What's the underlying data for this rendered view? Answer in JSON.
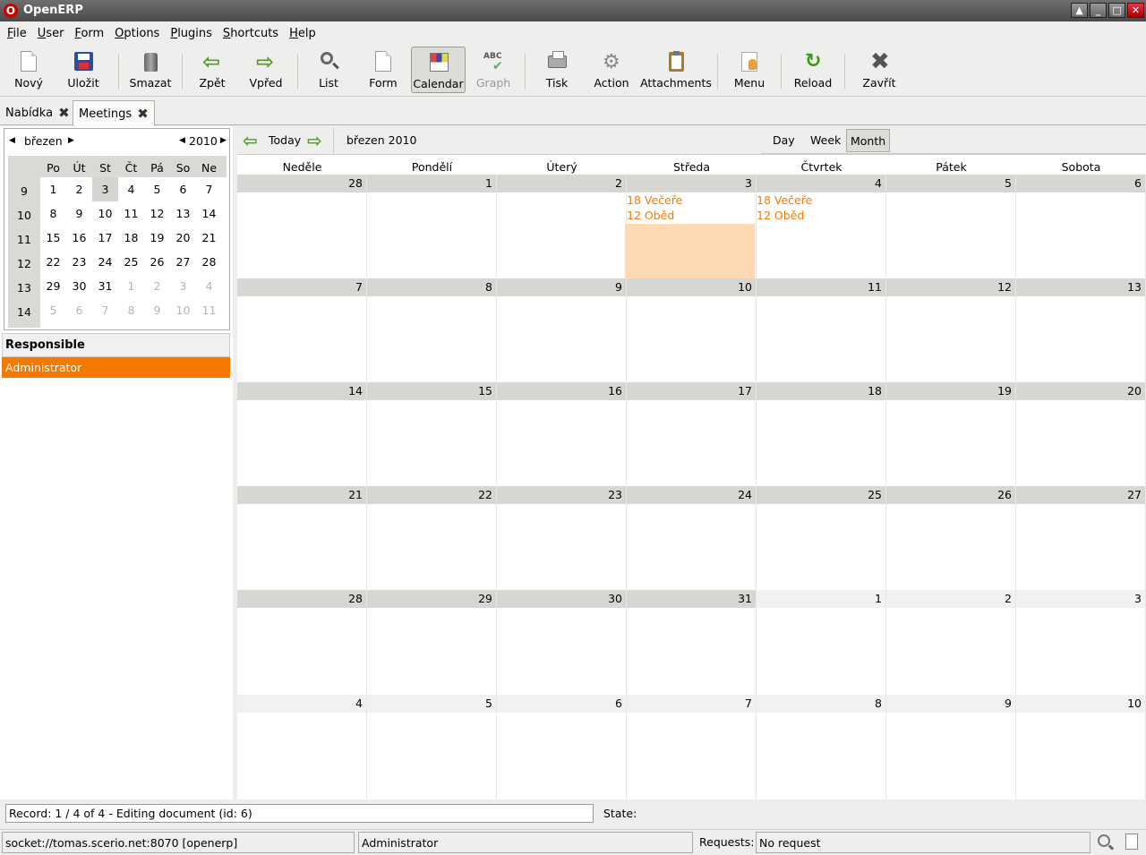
{
  "window": {
    "title": "OpenERP"
  },
  "menubar": [
    "File",
    "User",
    "Form",
    "Options",
    "Plugins",
    "Shortcuts",
    "Help"
  ],
  "toolbar": {
    "new": "Nový",
    "save": "Uložit",
    "delete": "Smazat",
    "back": "Zpět",
    "forward": "Vpřed",
    "list": "List",
    "form": "Form",
    "calendar": "Calendar",
    "graph": "Graph",
    "print": "Tisk",
    "action": "Action",
    "attachments": "Attachments",
    "menu": "Menu",
    "reload": "Reload",
    "close": "Zavřít"
  },
  "tabs": [
    {
      "label": "Nabídka",
      "active": false
    },
    {
      "label": "Meetings",
      "active": true
    }
  ],
  "minical": {
    "month": "březen",
    "year": "2010",
    "day_headers": [
      "Po",
      "Út",
      "St",
      "Čt",
      "Pá",
      "So",
      "Ne"
    ],
    "week_numbers": [
      "9",
      "10",
      "11",
      "12",
      "13",
      "14"
    ],
    "rows": [
      [
        "1",
        "2",
        "3",
        "4",
        "5",
        "6",
        "7"
      ],
      [
        "8",
        "9",
        "10",
        "11",
        "12",
        "13",
        "14"
      ],
      [
        "15",
        "16",
        "17",
        "18",
        "19",
        "20",
        "21"
      ],
      [
        "22",
        "23",
        "24",
        "25",
        "26",
        "27",
        "28"
      ],
      [
        "29",
        "30",
        "31",
        "1",
        "2",
        "3",
        "4"
      ],
      [
        "5",
        "6",
        "7",
        "8",
        "9",
        "10",
        "11"
      ]
    ],
    "selected": "3"
  },
  "responsible": {
    "header": "Responsible",
    "items": [
      "Administrator"
    ]
  },
  "calendar": {
    "today_label": "Today",
    "month_label": "březen 2010",
    "modes": [
      "Day",
      "Week",
      "Month"
    ],
    "active_mode": "Month",
    "weekdays": [
      "Neděle",
      "Pondělí",
      "Úterý",
      "Středa",
      "Čtvrtek",
      "Pátek",
      "Sobota"
    ],
    "weeks": [
      [
        "28",
        "1",
        "2",
        "3",
        "4",
        "5",
        "6"
      ],
      [
        "7",
        "8",
        "9",
        "10",
        "11",
        "12",
        "13"
      ],
      [
        "14",
        "15",
        "16",
        "17",
        "18",
        "19",
        "20"
      ],
      [
        "21",
        "22",
        "23",
        "24",
        "25",
        "26",
        "27"
      ],
      [
        "28",
        "29",
        "30",
        "31",
        "1",
        "2",
        "3"
      ],
      [
        "4",
        "5",
        "6",
        "7",
        "8",
        "9",
        "10"
      ]
    ],
    "events": {
      "wed_3": [
        "18 Večeře",
        "12 Oběd"
      ],
      "thu_4": [
        "18 Večeře",
        "12 Oběd"
      ]
    },
    "colors": {
      "event": "#f57900",
      "highlight": "#ffd9b4"
    }
  },
  "status": {
    "record": "Record: 1 / 4 of 4 - Editing document (id: 6)",
    "state_label": "State:",
    "server": "socket://tomas.scerio.net:8070 [openerp]",
    "user": "Administrator",
    "requests_label": "Requests:",
    "requests_value": "No request"
  }
}
